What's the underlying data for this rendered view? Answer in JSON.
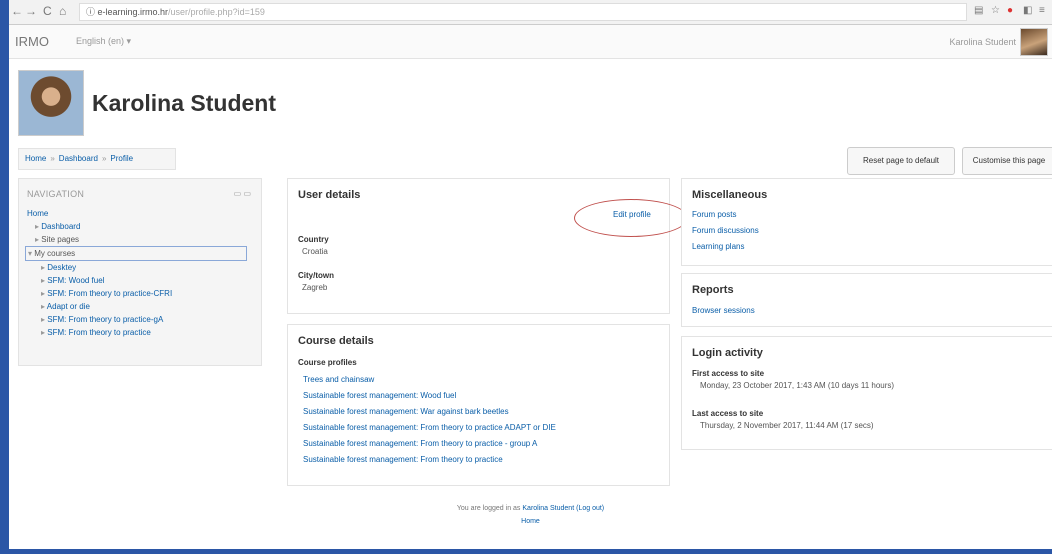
{
  "browser": {
    "nav_glyphs": [
      "←",
      "→",
      "C",
      "⌂"
    ],
    "url_host": "ⓘ e-learning.irmo.hr",
    "url_rest": "/user/profile.php?id=159"
  },
  "navbar": {
    "brand": "IRMO",
    "language": "English (en) ▾",
    "user_name": "Karolina Student"
  },
  "profile": {
    "full_name": "Karolina Student"
  },
  "breadcrumb": [
    "Home",
    "Dashboard",
    "Profile"
  ],
  "buttons": {
    "reset": "Reset page to default",
    "customise": "Customise this page"
  },
  "navigation": {
    "title": "NAVIGATION",
    "home": "Home",
    "dashboard": "Dashboard",
    "site_pages": "Site pages",
    "my_courses": "My courses",
    "courses": [
      "Desktey",
      "SFM: Wood fuel",
      "SFM: From theory to practice-CFRI",
      "Adapt or die",
      "SFM: From theory to practice-gA",
      "SFM: From theory to practice"
    ]
  },
  "user_details": {
    "title": "User details",
    "edit_profile": "Edit profile",
    "country_label": "Country",
    "country_value": "Croatia",
    "city_label": "City/town",
    "city_value": "Zagreb"
  },
  "course_details": {
    "title": "Course details",
    "profiles_label": "Course profiles",
    "courses": [
      "Trees and chainsaw",
      "Sustainable forest management: Wood fuel",
      "Sustainable forest management: War against bark beetles",
      "Sustainable forest management: From theory to practice ADAPT or DIE",
      "Sustainable forest management: From theory to practice - group A",
      "Sustainable forest management: From theory to practice"
    ]
  },
  "misc": {
    "title": "Miscellaneous",
    "links": [
      "Forum posts",
      "Forum discussions",
      "Learning plans"
    ]
  },
  "reports": {
    "title": "Reports",
    "links": [
      "Browser sessions"
    ]
  },
  "login_activity": {
    "title": "Login activity",
    "first_label": "First access to site",
    "first_value": "Monday, 23 October 2017, 1:43 AM  (10 days 11 hours)",
    "last_label": "Last access to site",
    "last_value": "Thursday, 2 November 2017, 11:44 AM  (17 secs)"
  },
  "footer": {
    "logged_prefix": "You are logged in as",
    "logged_user": "Karolina Student",
    "logout": "(Log out)",
    "home": "Home"
  },
  "colors": {
    "link": "#0a5ea8",
    "frame": "#2b56a6",
    "annotation": "#c0504d"
  }
}
